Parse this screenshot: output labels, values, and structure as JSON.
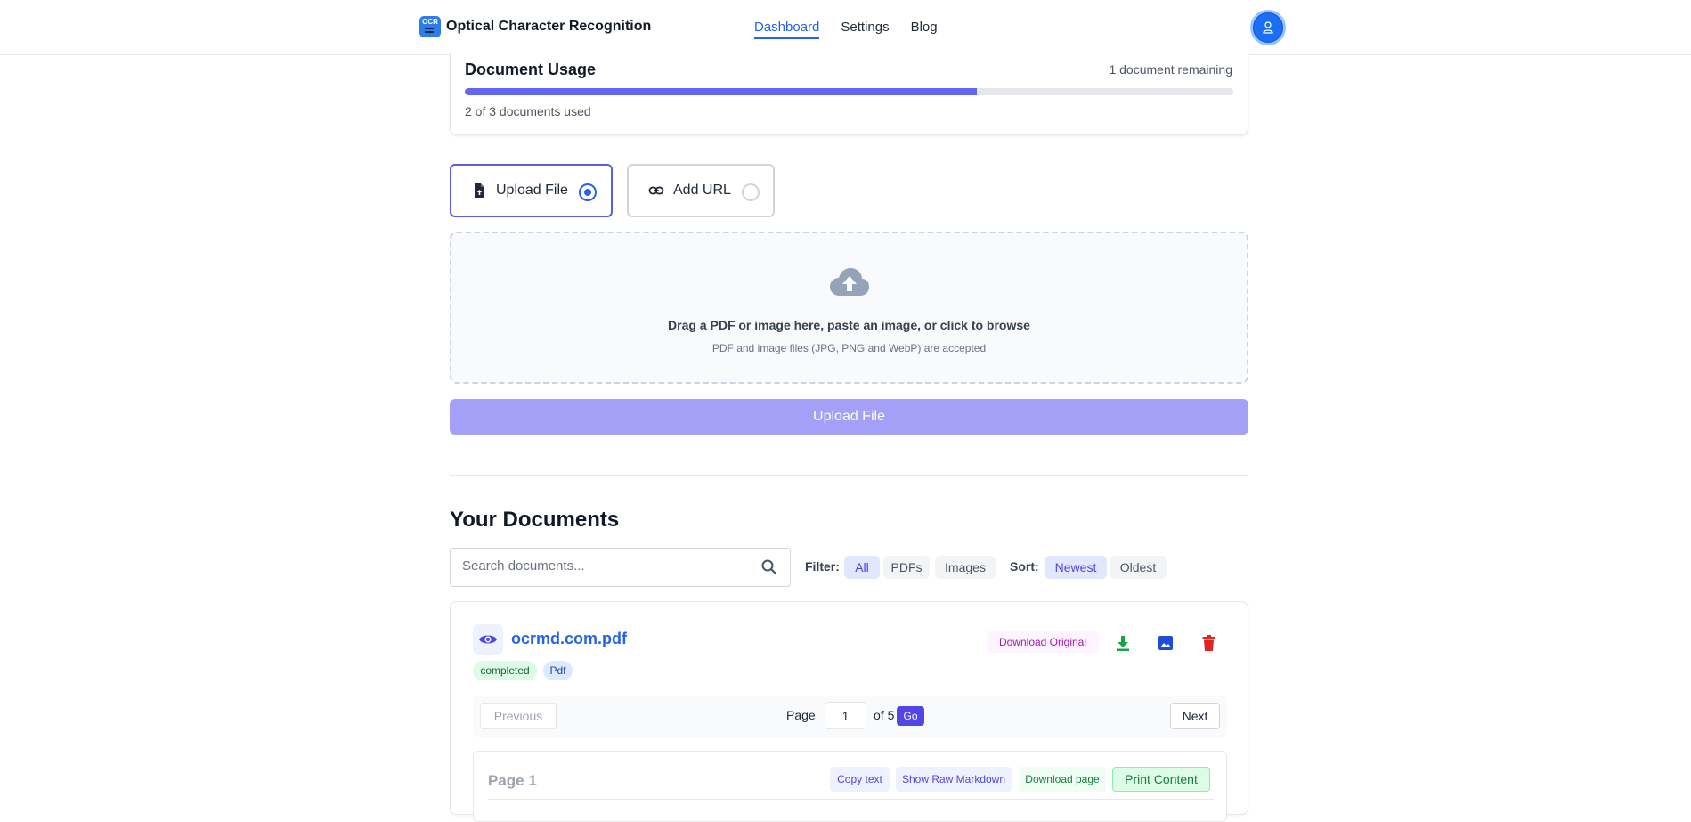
{
  "header": {
    "logo_text": "OCR",
    "title": "Optical Character Recognition",
    "nav": [
      {
        "label": "Dashboard",
        "active": true
      },
      {
        "label": "Settings",
        "active": false
      },
      {
        "label": "Blog",
        "active": false
      }
    ]
  },
  "usage": {
    "title": "Document Usage",
    "remaining": "1 document remaining",
    "used_text": "2 of 3 documents used",
    "used": 2,
    "total": 3
  },
  "source_tabs": {
    "upload_label": "Upload File",
    "url_label": "Add URL",
    "selected": "upload"
  },
  "dropzone": {
    "main_text": "Drag a PDF or image here, paste an image, or click to browse",
    "sub_text": "PDF and image files (JPG, PNG and WebP) are accepted"
  },
  "upload_button": "Upload File",
  "documents": {
    "title": "Your Documents",
    "search_placeholder": "Search documents...",
    "filter_label": "Filter:",
    "filters": [
      "All",
      "PDFs",
      "Images"
    ],
    "active_filter": "All",
    "sort_label": "Sort:",
    "sorts": [
      "Newest",
      "Oldest"
    ],
    "active_sort": "Newest",
    "items": [
      {
        "name": "ocrmd.com.pdf",
        "status": "completed",
        "type": "Pdf",
        "download_original": "Download Original",
        "pager": {
          "previous": "Previous",
          "page_label": "Page",
          "current_page": "1",
          "of_label": "of 5",
          "go": "Go",
          "next": "Next"
        },
        "page": {
          "title": "Page 1",
          "copy_text": "Copy text",
          "show_raw": "Show Raw Markdown",
          "download_page": "Download page",
          "print": "Print Content"
        }
      }
    ]
  },
  "colors": {
    "accent": "#4f46e5",
    "link": "#2563eb",
    "progress": "#6366f1",
    "upload_button_disabled": "#a5a0f7",
    "download_icon": "#16a34a",
    "image_icon": "#1d4ed8",
    "delete_icon": "#dc2626"
  },
  "icons": {
    "file_upload": "file-upload-icon",
    "link": "link-icon",
    "cloud_upload": "cloud-upload-icon",
    "search": "search-icon",
    "view": "eye-icon",
    "download": "download-icon",
    "image": "image-icon",
    "delete": "trash-icon",
    "user": "user-icon"
  }
}
